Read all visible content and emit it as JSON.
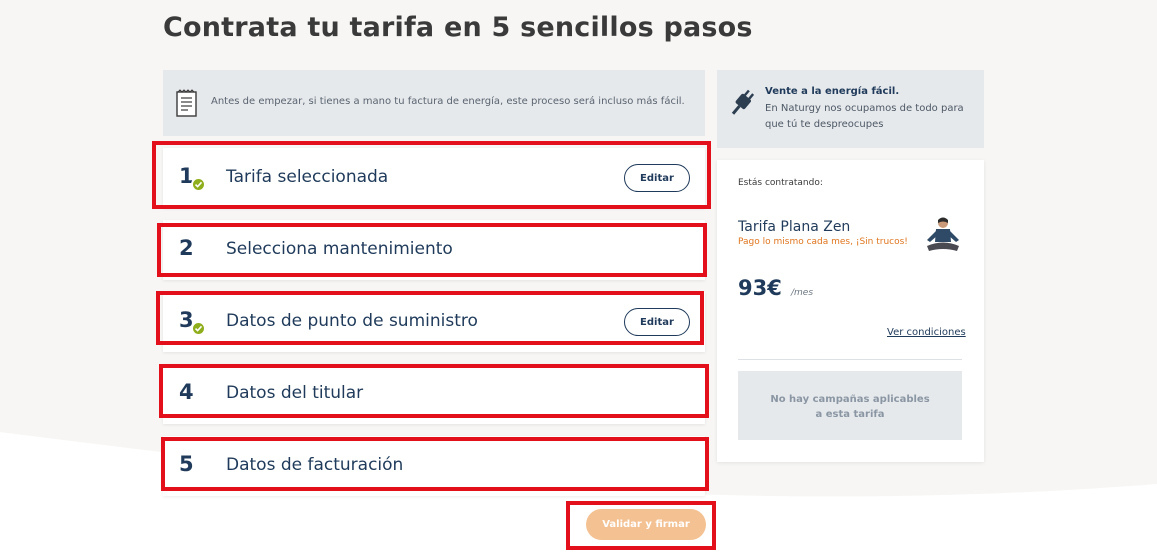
{
  "page": {
    "title": "Contrata tu tarifa en 5 sencillos pasos"
  },
  "info_box": {
    "text": "Antes de empezar, si tienes a mano tu factura de energía, este proceso será incluso más fácil."
  },
  "side_info": {
    "title": "Vente a la energía fácil.",
    "description": "En Naturgy nos ocupamos de todo para que tú te despreocupes"
  },
  "steps": [
    {
      "number": "1",
      "label": "Tarifa seleccionada",
      "completed": true,
      "edit_label": "Editar"
    },
    {
      "number": "2",
      "label": "Selecciona mantenimiento",
      "completed": false
    },
    {
      "number": "3",
      "label": "Datos de punto de suministro",
      "completed": true,
      "edit_label": "Editar"
    },
    {
      "number": "4",
      "label": "Datos del titular",
      "completed": false
    },
    {
      "number": "5",
      "label": "Datos de facturación",
      "completed": false
    }
  ],
  "summary": {
    "contracting_label": "Estás contratando:",
    "plan_name": "Tarifa Plana Zen",
    "plan_tagline": "Pago lo mismo cada mes, ¡Sin trucos!",
    "price": "93€",
    "price_period": "/mes",
    "conditions_link": "Ver condiciones",
    "campaign_line1": "No hay campañas aplicables",
    "campaign_line2": "a esta tarifa"
  },
  "submit_label": "Validar y firmar",
  "colors": {
    "navy": "#1f3a5a",
    "check_green": "#8fae1b",
    "highlight_red": "#e3101b",
    "submit_orange": "#f4c192",
    "tagline_orange": "#e0761f"
  }
}
